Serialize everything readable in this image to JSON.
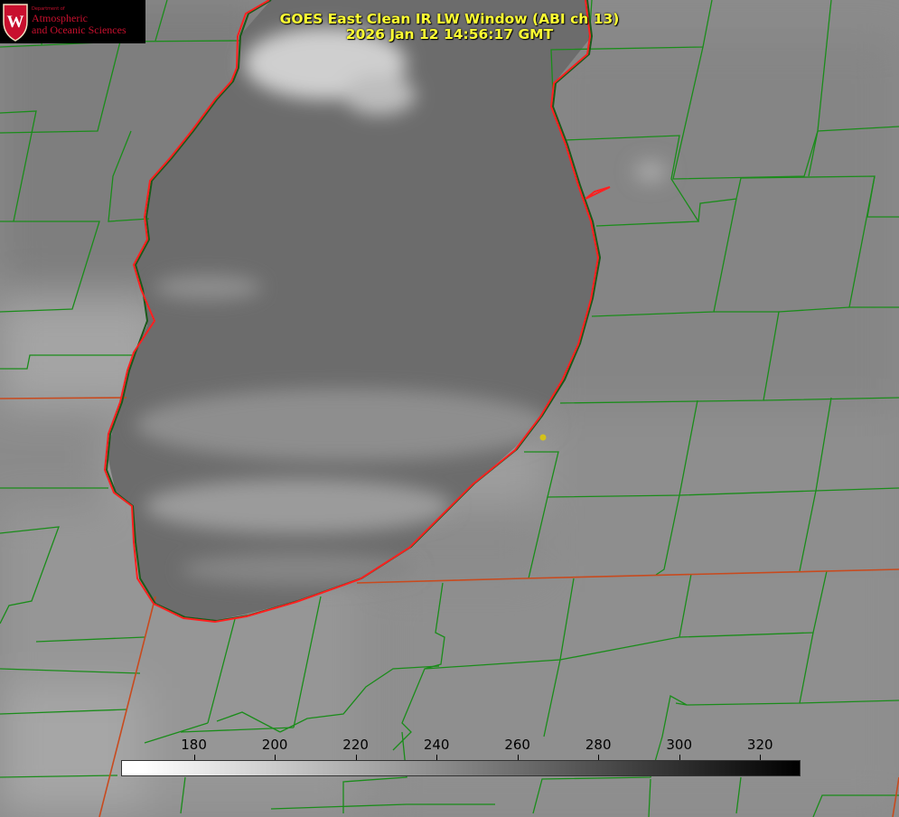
{
  "title": {
    "line1": "GOES East Clean IR LW Window (ABI ch 13)",
    "line2": "2026 Jan 12 14:56:17 GMT"
  },
  "logo": {
    "dept": "Department of",
    "name_line1": "Atmospheric",
    "name_line2": "and Oceanic Sciences",
    "crest_letter": "W"
  },
  "colorbar": {
    "ticks": [
      "180",
      "200",
      "220",
      "240",
      "260",
      "280",
      "300",
      "320"
    ],
    "range": [
      162,
      330
    ]
  },
  "colors": {
    "title": "#ffff33",
    "borders": "#1a8c1a",
    "coastline": "#ff2020",
    "state_line": "#c84a1e",
    "marker": "#d4c21a"
  }
}
